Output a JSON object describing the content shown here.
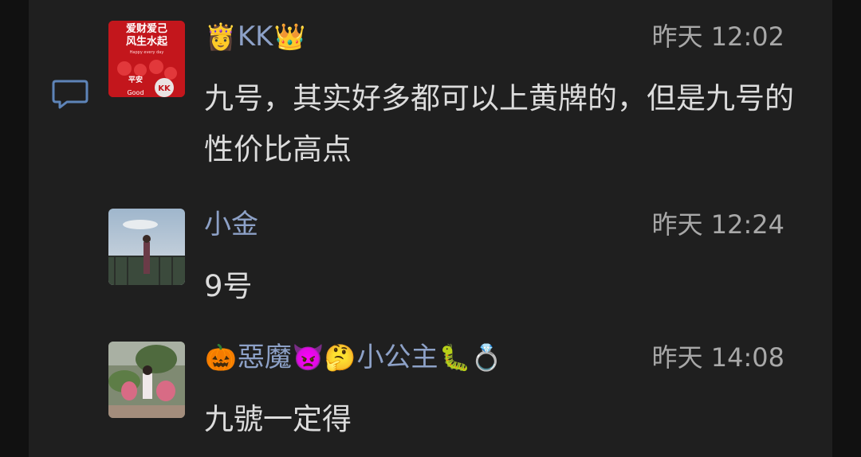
{
  "messages": [
    {
      "name_prefix": "👸",
      "name": "KK",
      "name_suffix": "👑",
      "time": "昨天 12:02",
      "text": "九号，其实好多都可以上黄牌的，但是九号的性价比高点",
      "avatar_lines": [
        "爱财爱己",
        "风生水起",
        "Happy every day",
        "平安",
        "Good",
        "KK"
      ]
    },
    {
      "name": "小金",
      "time": "昨天 12:24",
      "text": "9号"
    },
    {
      "name_prefix": "🎃",
      "name": "惡魔",
      "name_mid": "👿🤔",
      "name2": "小公主",
      "name_suffix": "🐛💍",
      "time": "昨天 14:08",
      "text": "九號一定得"
    }
  ],
  "colors": {
    "background": "#111111",
    "panel": "#1f1f1f",
    "name": "#8da1c7",
    "time": "#a8a8a8",
    "text": "#dcdcdc",
    "icon": "#5e84b8"
  },
  "icons": {
    "comment": "comment-bubble-icon"
  }
}
